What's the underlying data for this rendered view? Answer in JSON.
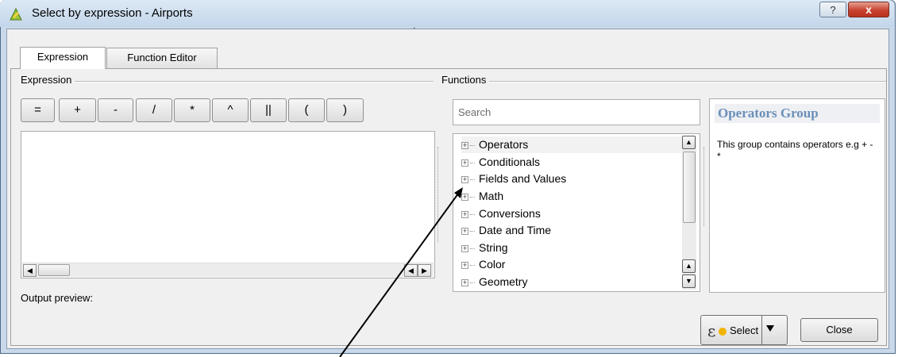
{
  "window": {
    "title": "Select by expression - Airports",
    "help_glyph": "?",
    "close_glyph": "x"
  },
  "tabs": [
    {
      "label": "Expression",
      "active": true
    },
    {
      "label": "Function Editor",
      "active": false
    }
  ],
  "expression_group": {
    "label": "Expression",
    "operators": [
      "=",
      "+",
      "-",
      "/",
      "*",
      "^",
      "||",
      "(",
      ")"
    ],
    "output_preview_label": "Output preview:"
  },
  "functions_group": {
    "label": "Functions",
    "search_placeholder": "Search",
    "tree_items": [
      "Operators",
      "Conditionals",
      "Fields and Values",
      "Math",
      "Conversions",
      "Date and Time",
      "String",
      "Color",
      "Geometry"
    ]
  },
  "help_panel": {
    "title": "Operators Group",
    "text": "This group contains operators e.g + - *"
  },
  "footer": {
    "select_label": "Select",
    "close_label": "Close"
  },
  "colors": {
    "help_title": "#6a8fb8",
    "window_frame": "#c9d9ea",
    "close_button": "#c8432f"
  }
}
